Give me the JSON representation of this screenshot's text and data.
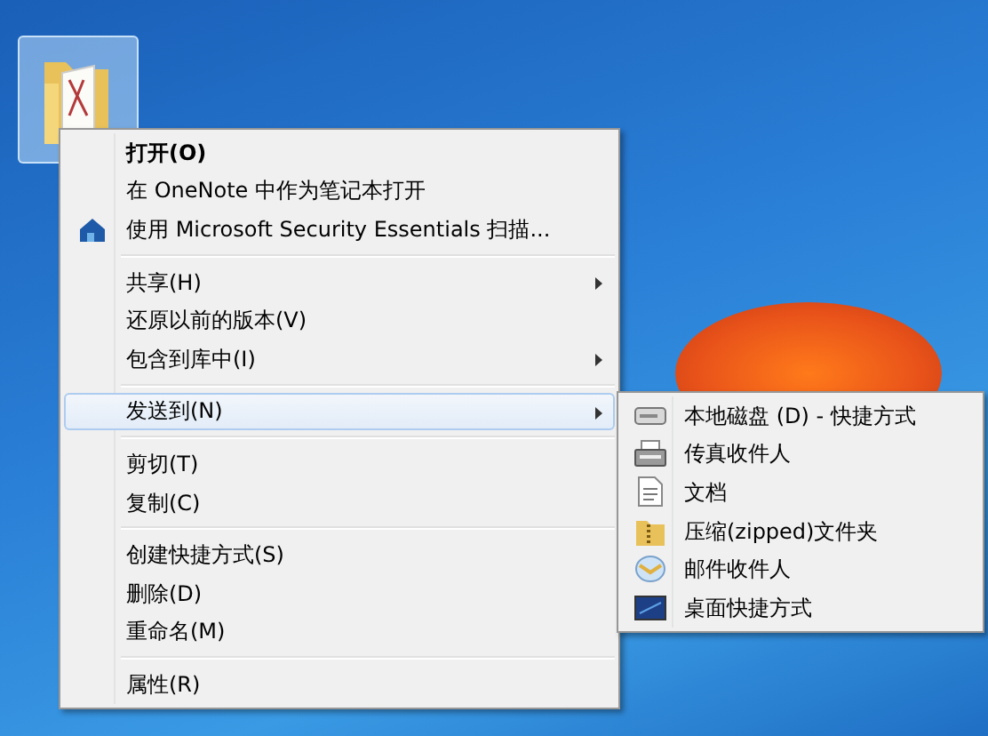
{
  "desktop": {
    "folder_icon": {
      "selected": true
    }
  },
  "context_menu": {
    "items": [
      {
        "kind": "item",
        "label": "打开(O)",
        "bold": true,
        "submenu": false,
        "selected": false
      },
      {
        "kind": "item",
        "label": "在 OneNote 中作为笔记本打开",
        "bold": false,
        "submenu": false,
        "selected": false
      },
      {
        "kind": "scan",
        "label": "使用 Microsoft Security Essentials 扫描...",
        "bold": false,
        "submenu": false,
        "selected": false
      },
      {
        "kind": "separator"
      },
      {
        "kind": "item",
        "label": "共享(H)",
        "bold": false,
        "submenu": true,
        "selected": false
      },
      {
        "kind": "item",
        "label": "还原以前的版本(V)",
        "bold": false,
        "submenu": false,
        "selected": false
      },
      {
        "kind": "item",
        "label": "包含到库中(I)",
        "bold": false,
        "submenu": true,
        "selected": false
      },
      {
        "kind": "separator"
      },
      {
        "kind": "item",
        "label": "发送到(N)",
        "bold": false,
        "submenu": true,
        "selected": true
      },
      {
        "kind": "separator"
      },
      {
        "kind": "item",
        "label": "剪切(T)",
        "bold": false,
        "submenu": false,
        "selected": false
      },
      {
        "kind": "item",
        "label": "复制(C)",
        "bold": false,
        "submenu": false,
        "selected": false
      },
      {
        "kind": "separator"
      },
      {
        "kind": "item",
        "label": "创建快捷方式(S)",
        "bold": false,
        "submenu": false,
        "selected": false
      },
      {
        "kind": "item",
        "label": "删除(D)",
        "bold": false,
        "submenu": false,
        "selected": false
      },
      {
        "kind": "item",
        "label": "重命名(M)",
        "bold": false,
        "submenu": false,
        "selected": false
      },
      {
        "kind": "separator"
      },
      {
        "kind": "item",
        "label": "属性(R)",
        "bold": false,
        "submenu": false,
        "selected": false
      }
    ]
  },
  "send_to_menu": {
    "items": [
      {
        "kind": "drive",
        "label": "本地磁盘 (D) - 快捷方式"
      },
      {
        "kind": "fax",
        "label": "传真收件人"
      },
      {
        "kind": "document",
        "label": "文档"
      },
      {
        "kind": "zip",
        "label": "压缩(zipped)文件夹"
      },
      {
        "kind": "mail",
        "label": "邮件收件人"
      },
      {
        "kind": "desktop",
        "label": "桌面快捷方式"
      }
    ]
  }
}
